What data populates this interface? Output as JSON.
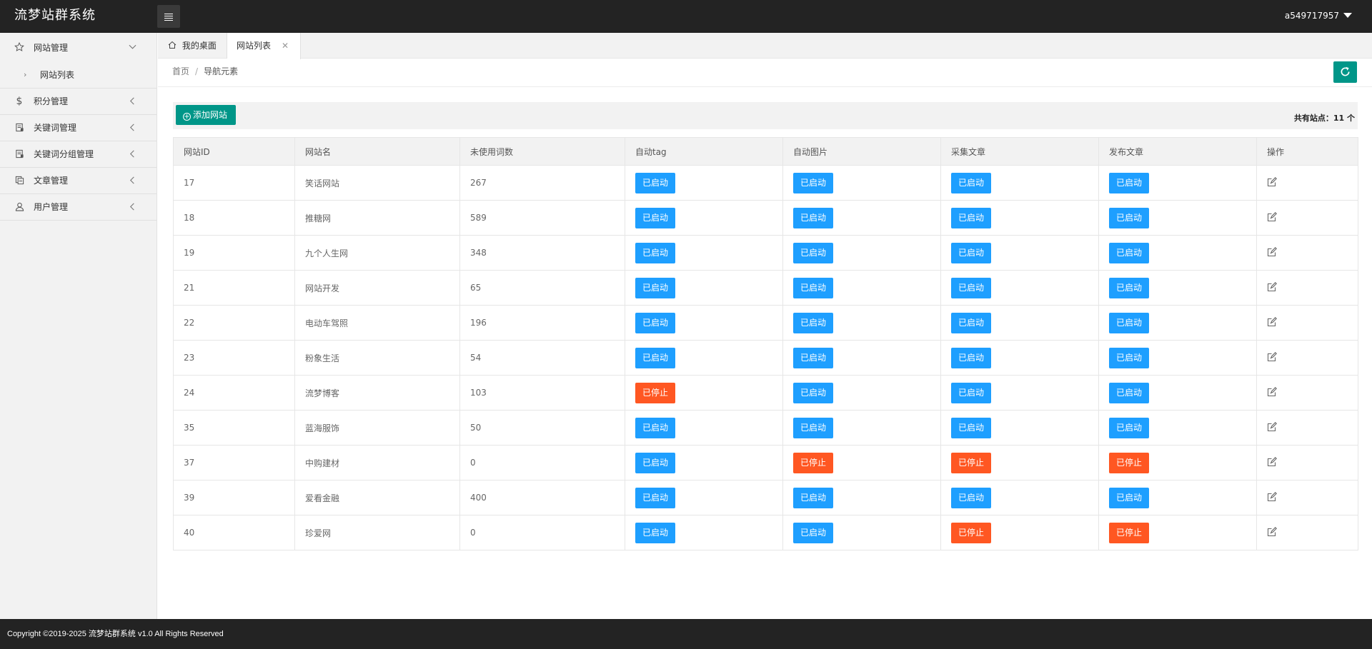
{
  "header": {
    "app_title": "流梦站群系统",
    "username": "a549717957"
  },
  "sidebar": {
    "items": [
      {
        "label": "网站管理",
        "icon": "star-icon",
        "expanded": true,
        "children": [
          {
            "label": "网站列表"
          }
        ]
      },
      {
        "label": "积分管理",
        "icon": "dollar-icon"
      },
      {
        "label": "关键词管理",
        "icon": "notebook-icon"
      },
      {
        "label": "关键词分组管理",
        "icon": "notebook-icon"
      },
      {
        "label": "文章管理",
        "icon": "copy-icon"
      },
      {
        "label": "用户管理",
        "icon": "user-icon"
      }
    ]
  },
  "tabs": [
    {
      "label": "我的桌面",
      "icon": "home-icon"
    },
    {
      "label": "网站列表",
      "active": true,
      "closable": true
    }
  ],
  "breadcrumb": {
    "home": "首页",
    "separator": "/",
    "current": "导航元素"
  },
  "toolbar": {
    "add_label": "添加网站",
    "count_label": "共有站点：",
    "count_value": "11 个"
  },
  "table": {
    "headers": [
      "网站ID",
      "网站名",
      "未使用词数",
      "自动tag",
      "自动图片",
      "采集文章",
      "发布文章",
      "操作"
    ],
    "status_labels": {
      "on": "已启动",
      "off": "已停止"
    },
    "rows": [
      {
        "id": "17",
        "name": "笑话网站",
        "unused": "267",
        "auto_tag": "on",
        "auto_img": "on",
        "collect": "on",
        "publish": "on"
      },
      {
        "id": "18",
        "name": "推糖网",
        "unused": "589",
        "auto_tag": "on",
        "auto_img": "on",
        "collect": "on",
        "publish": "on"
      },
      {
        "id": "19",
        "name": "九个人生网",
        "unused": "348",
        "auto_tag": "on",
        "auto_img": "on",
        "collect": "on",
        "publish": "on"
      },
      {
        "id": "21",
        "name": "网站开发",
        "unused": "65",
        "auto_tag": "on",
        "auto_img": "on",
        "collect": "on",
        "publish": "on"
      },
      {
        "id": "22",
        "name": "电动车驾照",
        "unused": "196",
        "auto_tag": "on",
        "auto_img": "on",
        "collect": "on",
        "publish": "on"
      },
      {
        "id": "23",
        "name": "粉象生活",
        "unused": "54",
        "auto_tag": "on",
        "auto_img": "on",
        "collect": "on",
        "publish": "on"
      },
      {
        "id": "24",
        "name": "流梦博客",
        "unused": "103",
        "auto_tag": "off",
        "auto_img": "on",
        "collect": "on",
        "publish": "on"
      },
      {
        "id": "35",
        "name": "蓝海服饰",
        "unused": "50",
        "auto_tag": "on",
        "auto_img": "on",
        "collect": "on",
        "publish": "on"
      },
      {
        "id": "37",
        "name": "中购建材",
        "unused": "0",
        "auto_tag": "on",
        "auto_img": "off",
        "collect": "off",
        "publish": "off"
      },
      {
        "id": "39",
        "name": "爱看金融",
        "unused": "400",
        "auto_tag": "on",
        "auto_img": "on",
        "collect": "on",
        "publish": "on"
      },
      {
        "id": "40",
        "name": "珍爱网",
        "unused": "0",
        "auto_tag": "on",
        "auto_img": "on",
        "collect": "off",
        "publish": "off"
      }
    ]
  },
  "footer": {
    "copyright": "Copyright ©2019-2025 流梦站群系统 v1.0 All Rights Reserved"
  },
  "colors": {
    "header_bg": "#232323",
    "accent_green": "#009688",
    "status_on": "#1e9fff",
    "status_off": "#ff5722"
  }
}
